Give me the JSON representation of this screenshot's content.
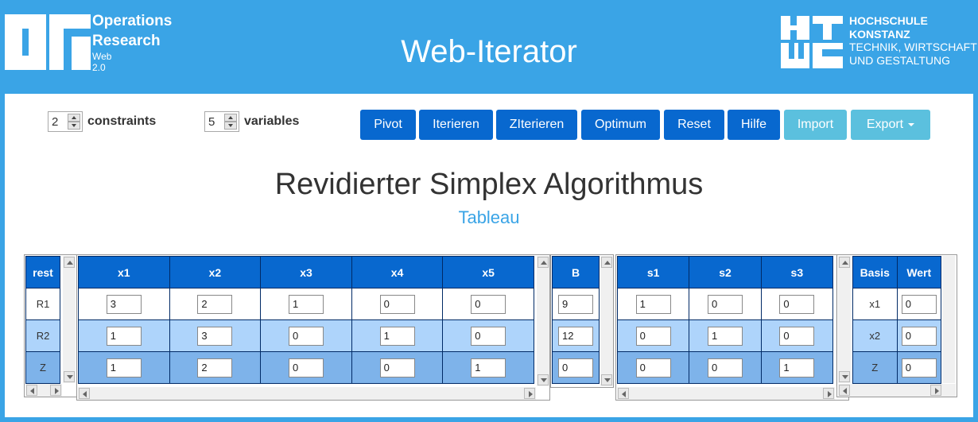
{
  "header": {
    "logo_lines": [
      "Operations",
      "Research",
      "Web",
      "2.0"
    ],
    "app_title": "Web-Iterator",
    "university_lines": [
      "HOCHSCHULE",
      "KONSTANZ",
      "TECHNIK, WIRTSCHAFT",
      "UND GESTALTUNG"
    ]
  },
  "controls": {
    "constraints": {
      "value": "2",
      "label": "constraints"
    },
    "variables": {
      "value": "5",
      "label": "variables"
    }
  },
  "toolbar": {
    "buttons": [
      "Pivot",
      "Iterieren",
      "ZIterieren",
      "Optimum",
      "Reset",
      "Hilfe",
      "Import",
      "Export"
    ]
  },
  "main": {
    "title": "Revidierter Simplex Algorithmus",
    "subtitle": "Tableau"
  },
  "tables": {
    "rest": {
      "header": "rest",
      "rows": [
        "R1",
        "R2",
        "Z"
      ]
    },
    "vars": {
      "headers": [
        "x1",
        "x2",
        "x3",
        "x4",
        "x5"
      ],
      "rows": [
        [
          "3",
          "2",
          "1",
          "0",
          "0"
        ],
        [
          "1",
          "3",
          "0",
          "1",
          "0"
        ],
        [
          "1",
          "2",
          "0",
          "0",
          "1"
        ]
      ]
    },
    "b": {
      "header": "B",
      "rows": [
        "9",
        "12",
        "0"
      ]
    },
    "slack": {
      "headers": [
        "s1",
        "s2",
        "s3"
      ],
      "rows": [
        [
          "1",
          "0",
          "0"
        ],
        [
          "0",
          "1",
          "0"
        ],
        [
          "0",
          "0",
          "1"
        ]
      ]
    },
    "basis": {
      "headers": [
        "Basis",
        "Wert"
      ],
      "rows": [
        [
          "x1",
          "0"
        ],
        [
          "x2",
          "0"
        ],
        [
          "Z",
          "0"
        ]
      ]
    }
  },
  "colors": {
    "primary": "#0868cf",
    "header_bg": "#3aa4e6",
    "light_button": "#5bc0de",
    "row_light": "#aed4fb",
    "row_mid": "#7eb3ea"
  }
}
